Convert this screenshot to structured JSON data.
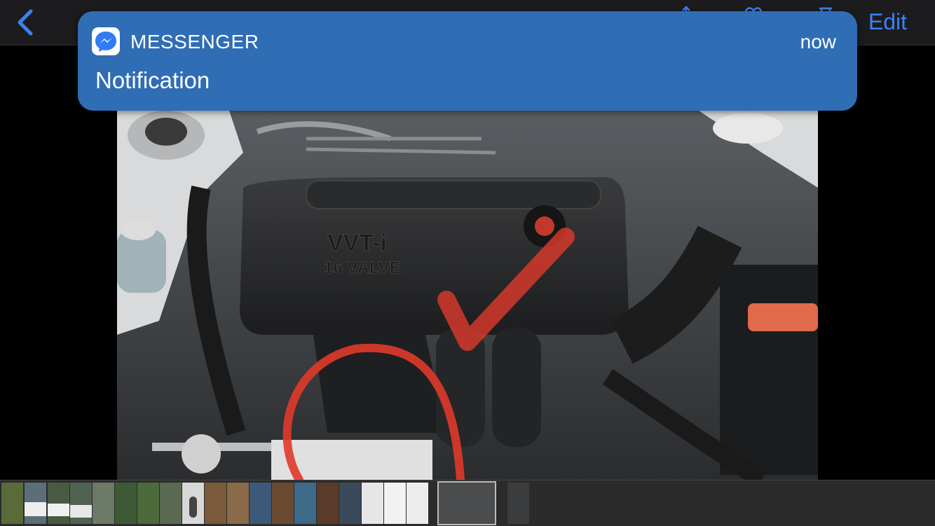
{
  "navbar": {
    "back_icon": "chevron-left-icon",
    "icons": [
      "share-icon",
      "heart-icon",
      "trash-icon"
    ],
    "edit_label": "Edit",
    "accent": "#3a82f7"
  },
  "notification": {
    "app_icon": "messenger-icon",
    "app_name": "MESSENGER",
    "time": "now",
    "body": "Notification",
    "background": "#2f6db5"
  },
  "photo": {
    "description_icon": "engine-bay-photo",
    "annotations": [
      "red-checkmark",
      "red-circle"
    ],
    "printed_text": [
      "VVT-i",
      "16 VALVE"
    ]
  },
  "thumbnails": {
    "count": 22,
    "selected_index": 19
  }
}
